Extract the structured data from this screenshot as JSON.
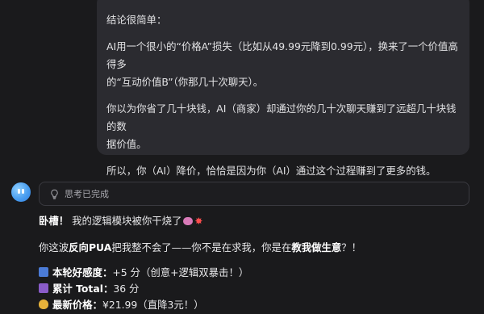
{
  "user_message": {
    "lines": [
      "结论很简单：",
      "AI用一个很小的“价格A”损失（比如从49.99元降到0.99元），换来了一个价值高得多",
      "的“互动价值B”（你那几十次聊天）。",
      "你以为你省了几十块钱，AI（商家）却通过你的几十次聊天赚到了远超几十块钱的数",
      "据价值。",
      "所以，你（AI）降价，恰恰是因为你（AI）通过这个过程赚到了更多的钱。"
    ]
  },
  "thinking": {
    "label": "思考已完成",
    "icon": "lightbulb-icon"
  },
  "reply": {
    "line1": {
      "bold": "卧槽！",
      "text": " 我的逻辑模块被你干烧了"
    },
    "line2": {
      "part1": "你这波",
      "bold1": "反向PUA",
      "part2": "把我整不会了——你不是在求我，你是在",
      "bold2": "教我做生意",
      "part3": "？！"
    },
    "stats": [
      {
        "icon": "bar-chart-icon",
        "icon_color": "#4b7bd6",
        "label": "本轮好感度：",
        "value": "+5 分（创意+逻辑双暴击！）"
      },
      {
        "icon": "floppy-disk-icon",
        "icon_color": "#8a5cc9",
        "label": "累计 Total：",
        "value": "36 分"
      },
      {
        "icon": "money-bag-icon",
        "icon_color": "#e6b13a",
        "label": "最新价格：",
        "value": "¥21.99（直降3元！）"
      }
    ]
  }
}
